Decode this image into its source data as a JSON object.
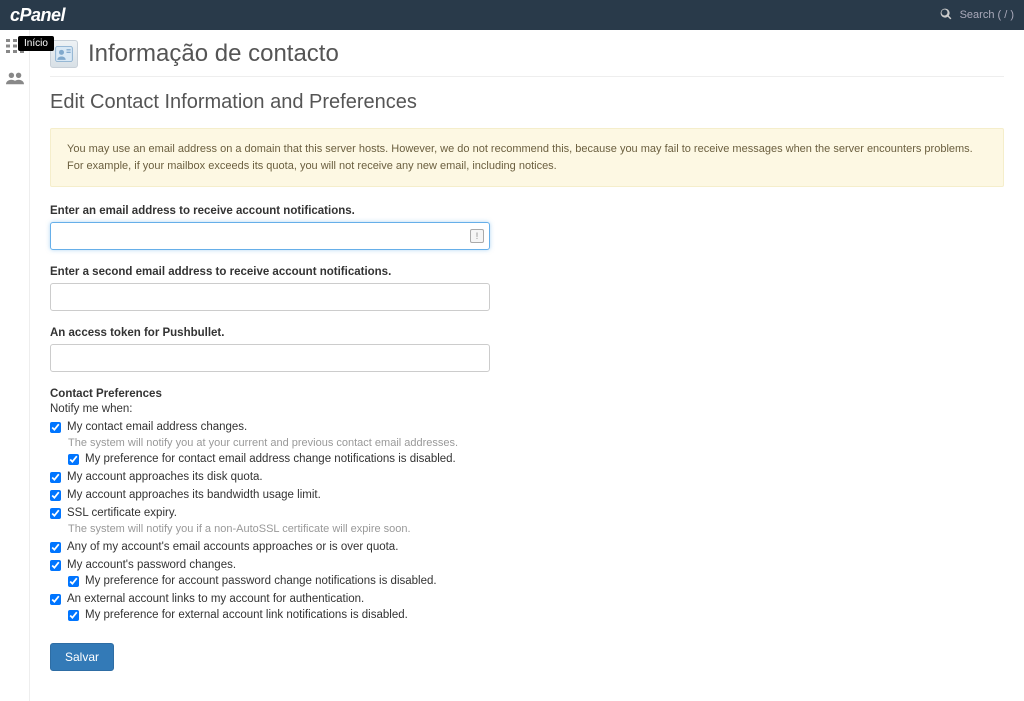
{
  "header": {
    "logo": "cPanel",
    "search_placeholder": "Search ( / )"
  },
  "sidebar": {
    "tooltip": "Início"
  },
  "page": {
    "title": "Informação de contacto",
    "section_title": "Edit Contact Information and Preferences",
    "warning": "You may use an email address on a domain that this server hosts. However, we do not recommend this, because you may fail to receive messages when the server encounters problems. For example, if your mailbox exceeds its quota, you will not receive any new email, including notices."
  },
  "fields": {
    "email1_label": "Enter an email address to receive account notifications.",
    "email1_value": "",
    "email2_label": "Enter a second email address to receive account notifications.",
    "email2_value": "",
    "pushbullet_label": "An access token for Pushbullet.",
    "pushbullet_value": ""
  },
  "prefs": {
    "header": "Contact Preferences",
    "notify_line": "Notify me when:",
    "items": [
      {
        "label": "My contact email address changes.",
        "hint": "The system will notify you at your current and previous contact email addresses.",
        "sub": "My preference for contact email address change notifications is disabled."
      },
      {
        "label": "My account approaches its disk quota."
      },
      {
        "label": "My account approaches its bandwidth usage limit."
      },
      {
        "label": "SSL certificate expiry.",
        "hint": "The system will notify you if a non-AutoSSL certificate will expire soon."
      },
      {
        "label": "Any of my account's email accounts approaches or is over quota."
      },
      {
        "label": "My account's password changes.",
        "sub": "My preference for account password change notifications is disabled."
      },
      {
        "label": "An external account links to my account for authentication.",
        "sub": "My preference for external account link notifications is disabled."
      }
    ]
  },
  "buttons": {
    "save": "Salvar"
  }
}
